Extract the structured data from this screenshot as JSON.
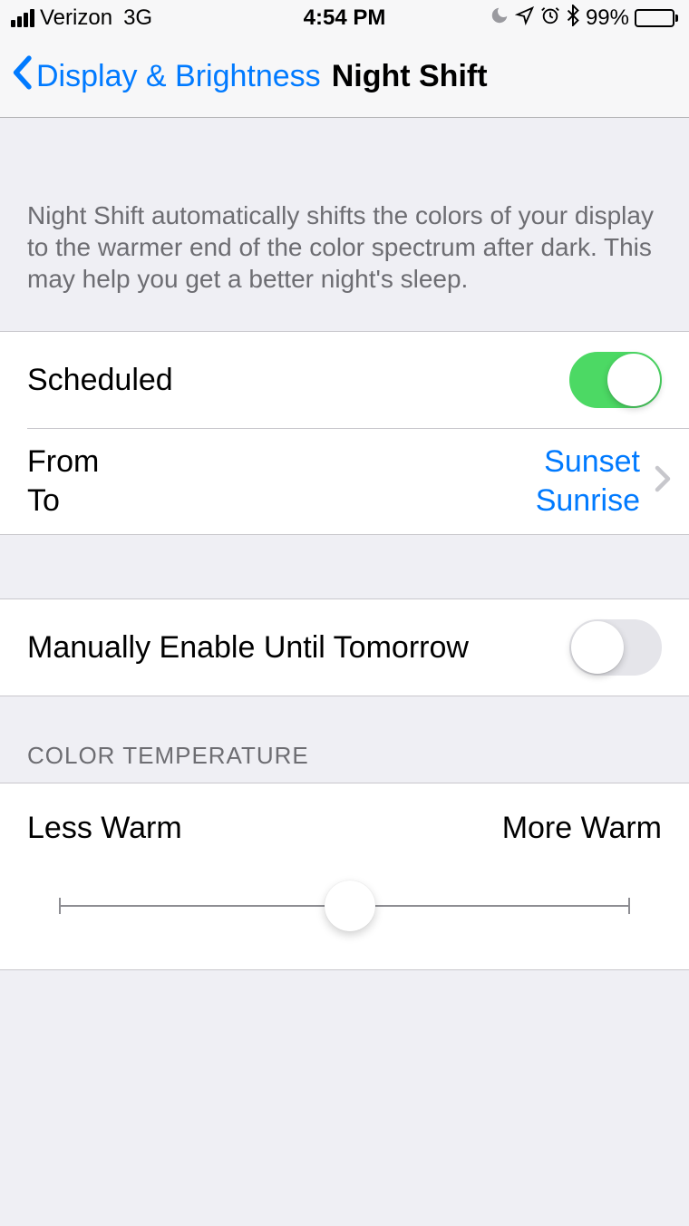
{
  "status_bar": {
    "carrier": "Verizon",
    "network": "3G",
    "time": "4:54 PM",
    "battery_percent": "99%"
  },
  "nav": {
    "back_label": "Display & Brightness",
    "title": "Night Shift"
  },
  "description": "Night Shift automatically shifts the colors of your display to the warmer end of the color spectrum after dark. This may help you get a better night's sleep.",
  "scheduled": {
    "label": "Scheduled",
    "enabled": true
  },
  "schedule_range": {
    "from_label": "From",
    "to_label": "To",
    "from_value": "Sunset",
    "to_value": "Sunrise"
  },
  "manual": {
    "label": "Manually Enable Until Tomorrow",
    "enabled": false
  },
  "color_temp": {
    "section_header": "COLOR TEMPERATURE",
    "left_label": "Less Warm",
    "right_label": "More Warm",
    "value_percent": 51
  }
}
